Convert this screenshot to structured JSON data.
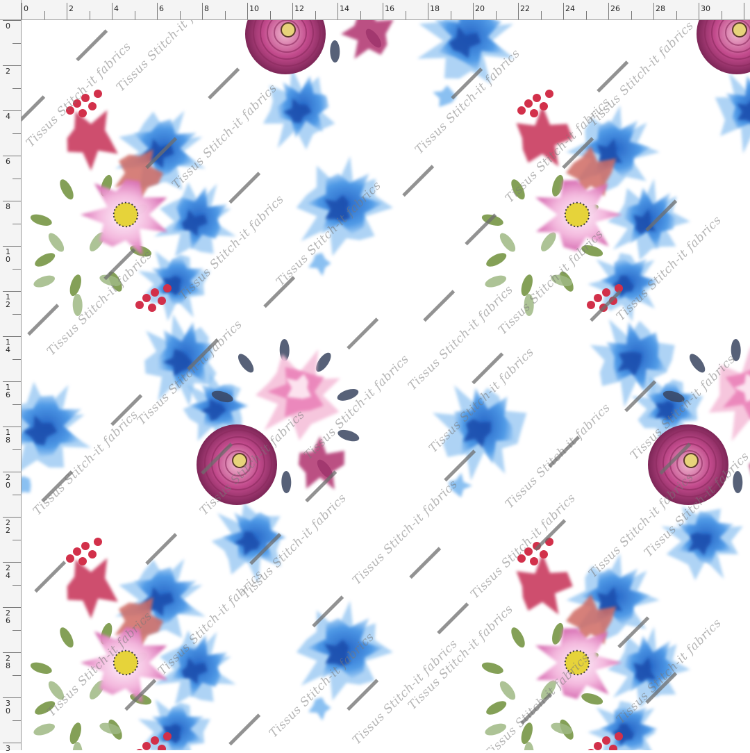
{
  "ruler": {
    "top_labels": [
      "0",
      "2",
      "4",
      "6",
      "8",
      "10",
      "12",
      "14",
      "16",
      "18",
      "20",
      "22",
      "24",
      "26",
      "28",
      "30"
    ],
    "left_labels": [
      "0",
      "2",
      "4",
      "6",
      "8",
      "10",
      "12",
      "14",
      "16",
      "18",
      "20",
      "22",
      "24",
      "26",
      "28",
      "30",
      "3"
    ]
  },
  "watermark": {
    "text": "Tissus Stitch-it fabrics"
  },
  "colors": {
    "blue": "#2f7fd9",
    "light_blue": "#5aa6ec",
    "pink": "#e98fc9",
    "magenta": "#b03c7d",
    "red": "#d2304a",
    "green": "#6f8f3a",
    "yellow": "#e6d33a"
  }
}
